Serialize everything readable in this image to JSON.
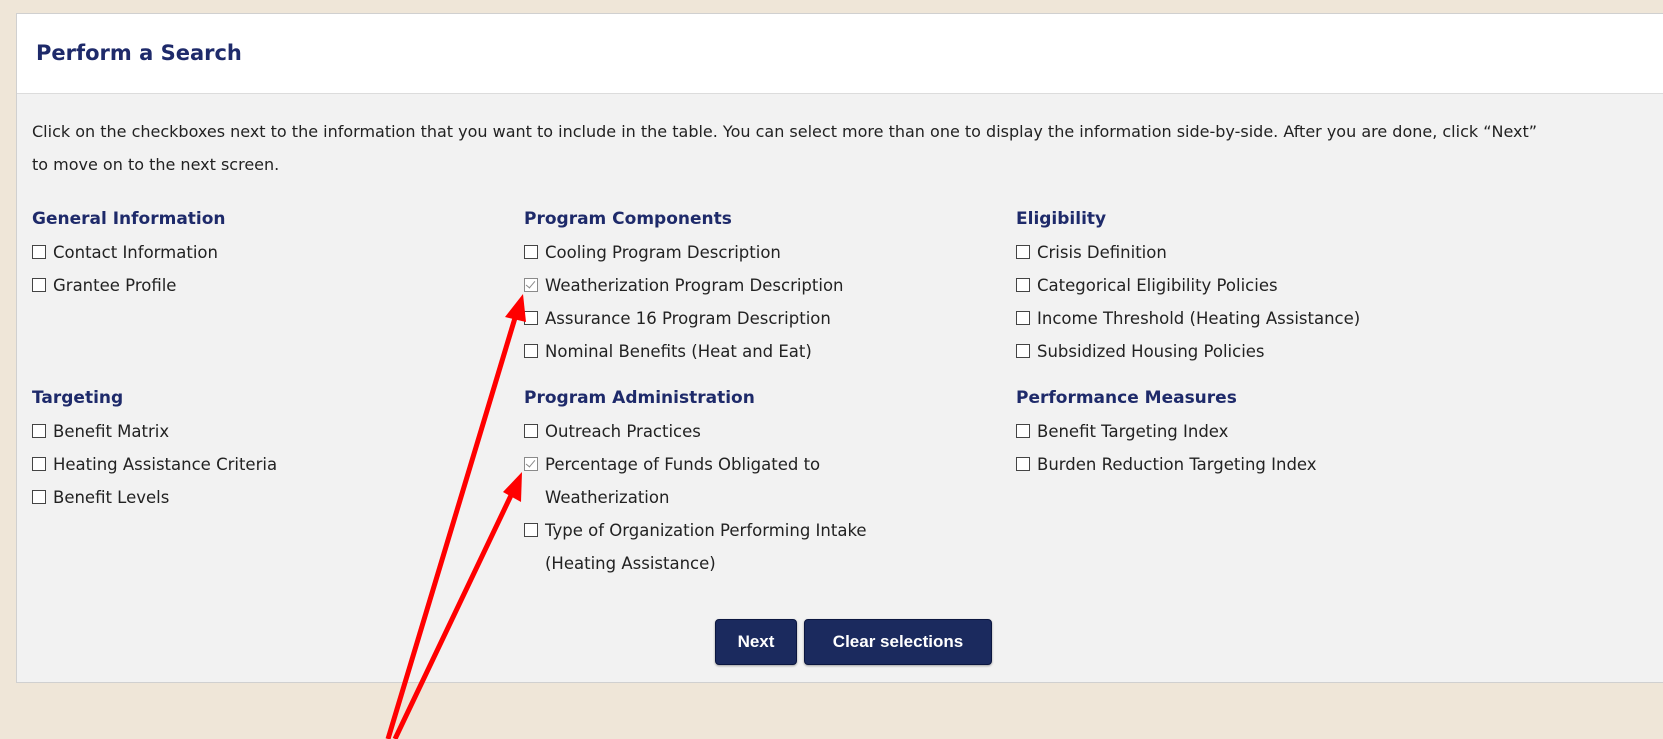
{
  "panel": {
    "title": "Perform a Search",
    "intro": "Click on the checkboxes next to the information that you want to include in the table. You can select more than one to display the information side-by-side. After you are done, click “Next” to move on to the next screen."
  },
  "groups": {
    "general": {
      "title": "General Information",
      "items": [
        {
          "label": "Contact Information",
          "checked": false
        },
        {
          "label": "Grantee Profile",
          "checked": false
        }
      ]
    },
    "targeting": {
      "title": "Targeting",
      "items": [
        {
          "label": "Benefit Matrix",
          "checked": false
        },
        {
          "label": "Heating Assistance Criteria",
          "checked": false
        },
        {
          "label": "Benefit Levels",
          "checked": false
        }
      ]
    },
    "program_components": {
      "title": "Program Components",
      "items": [
        {
          "label": "Cooling Program Description",
          "checked": false
        },
        {
          "label": "Weatherization Program Description",
          "checked": true
        },
        {
          "label": "Assurance 16 Program Description",
          "checked": false
        },
        {
          "label": "Nominal Benefits (Heat and Eat)",
          "checked": false
        }
      ]
    },
    "program_admin": {
      "title": "Program Administration",
      "items": [
        {
          "label": "Outreach Practices",
          "checked": false
        },
        {
          "label": "Percentage of Funds Obligated to Weatherization",
          "checked": true
        },
        {
          "label": "Type of Organization Performing Intake (Heating Assistance)",
          "checked": false
        }
      ]
    },
    "eligibility": {
      "title": "Eligibility",
      "items": [
        {
          "label": "Crisis Definition",
          "checked": false
        },
        {
          "label": "Categorical Eligibility Policies",
          "checked": false
        },
        {
          "label": "Income Threshold (Heating Assistance)",
          "checked": false
        },
        {
          "label": "Subsidized Housing Policies",
          "checked": false
        }
      ]
    },
    "performance": {
      "title": "Performance Measures",
      "items": [
        {
          "label": "Benefit Targeting Index",
          "checked": false
        },
        {
          "label": "Burden Reduction Targeting Index",
          "checked": false
        }
      ]
    }
  },
  "buttons": {
    "next": "Next",
    "clear": "Clear selections"
  },
  "colors": {
    "heading": "#1e2a6a",
    "button": "#1b2a5e",
    "annotation_arrow": "#ff0000"
  }
}
